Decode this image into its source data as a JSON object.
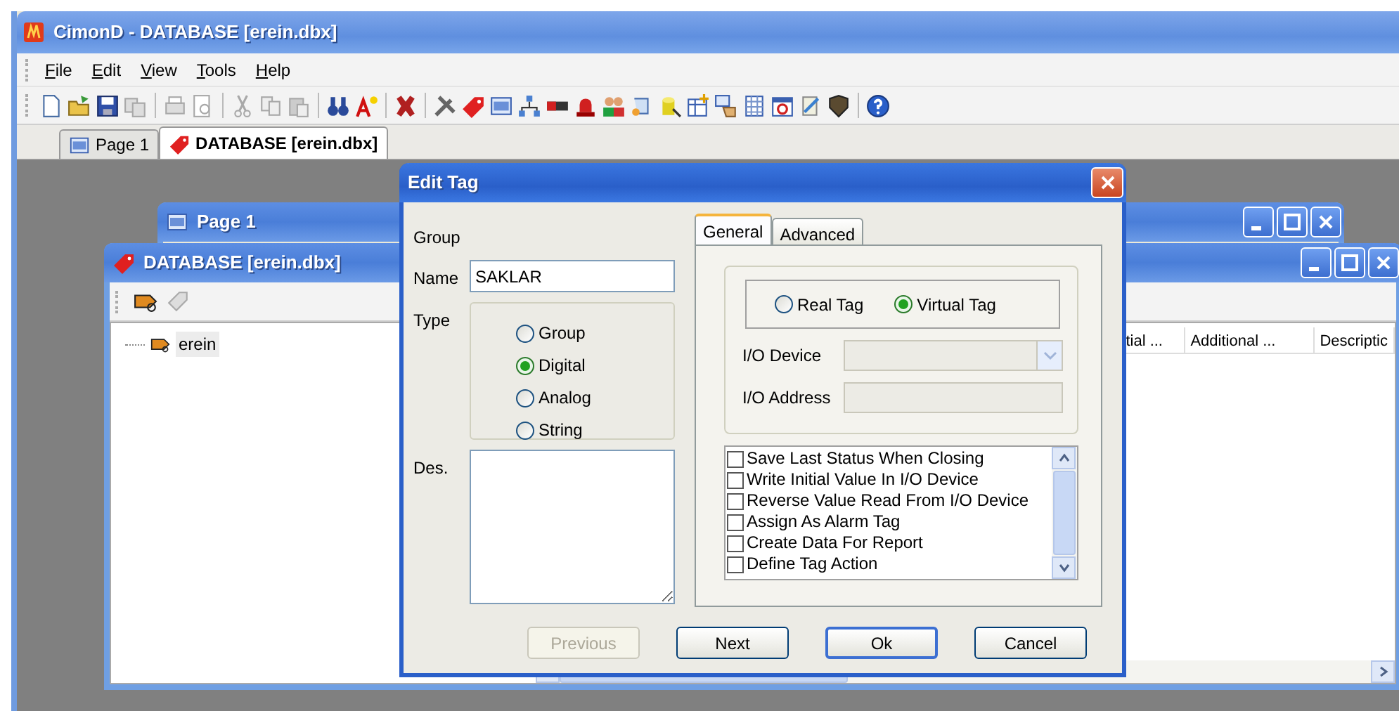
{
  "app": {
    "title": "CimonD - DATABASE [erein.dbx]"
  },
  "menu": [
    {
      "label": "File"
    },
    {
      "label": "Edit"
    },
    {
      "label": "View"
    },
    {
      "label": "Tools"
    },
    {
      "label": "Help"
    }
  ],
  "document_tabs": [
    {
      "label": "Page 1",
      "selected": false
    },
    {
      "label": "DATABASE [erein.dbx]",
      "selected": true
    }
  ],
  "windows": [
    {
      "kind": "page",
      "title": "Page 1"
    },
    {
      "kind": "database",
      "title": "DATABASE [erein.dbx]",
      "tree": [
        {
          "label": "erein",
          "selected": true
        }
      ],
      "list_columns": [
        "tial ...",
        "Additional ...",
        "Descriptic"
      ]
    }
  ],
  "dialog": {
    "title": "Edit Tag",
    "group_label": "Group",
    "name_label": "Name",
    "name_value": "SAKLAR",
    "type_label": "Type",
    "type_options": [
      {
        "label": "Group",
        "selected": false
      },
      {
        "label": "Digital",
        "selected": true
      },
      {
        "label": "Analog",
        "selected": false
      },
      {
        "label": "String",
        "selected": false
      }
    ],
    "des_label": "Des.",
    "tabs": [
      {
        "label": "General",
        "selected": true
      },
      {
        "label": "Advanced",
        "selected": false
      }
    ],
    "tag_kinds": [
      {
        "label": "Real Tag",
        "selected": false
      },
      {
        "label": "Virtual Tag",
        "selected": true
      }
    ],
    "io_device": {
      "label": "I/O Device",
      "disabled": true
    },
    "io_address": {
      "label": "I/O Address",
      "disabled": true
    },
    "options": [
      {
        "label": "Save Last Status When Closing",
        "checked": false
      },
      {
        "label": "Write Initial Value In I/O Device",
        "checked": false
      },
      {
        "label": "Reverse Value Read From I/O Device",
        "checked": false
      },
      {
        "label": "Assign As Alarm Tag",
        "checked": false
      },
      {
        "label": "Create Data For Report",
        "checked": false
      },
      {
        "label": "Define Tag Action",
        "checked": false
      }
    ],
    "buttons": [
      {
        "label": "Previous",
        "disabled": true,
        "default": false
      },
      {
        "label": "Next",
        "disabled": false,
        "default": false
      },
      {
        "label": "Ok",
        "disabled": false,
        "default": true
      },
      {
        "label": "Cancel",
        "disabled": false,
        "default": false
      }
    ]
  }
}
